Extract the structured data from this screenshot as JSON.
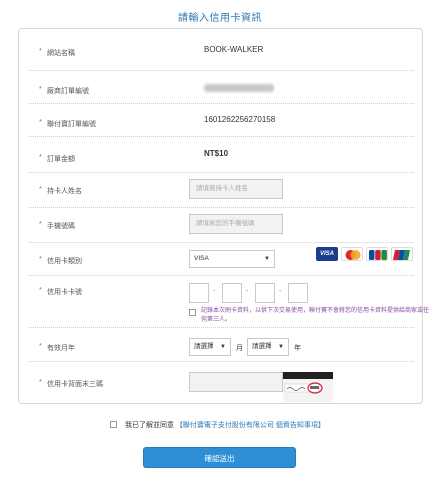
{
  "page": {
    "title": "請輸入信用卡資訊"
  },
  "form": {
    "site_name": {
      "label": "網站名稱",
      "value": "BOOK-WALKER"
    },
    "store_order": {
      "label": "廠商訂單編號",
      "value": ""
    },
    "payment_order": {
      "label": "聯付寶訂單編號",
      "value": "1601262256270158"
    },
    "amount": {
      "label": "訂單金額",
      "value": "NT$10"
    },
    "cardholder": {
      "label": "持卡人姓名",
      "placeholder": "請填寫持卡人姓名"
    },
    "phone": {
      "label": "手機號碼",
      "placeholder": "請填寫您的手機號碼"
    },
    "card_type": {
      "label": "信用卡類別",
      "selected": "VISA",
      "logos": [
        "VISA",
        "MasterCard",
        "JCB",
        "UnionPay"
      ]
    },
    "card_number": {
      "label": "信用卡卡號",
      "separator": "-",
      "remember_note": "記錄本次刷卡資料，以供下次交易使用，聯付寶不會將您的信用卡資料提供給商家或任何第三人。"
    },
    "expiry": {
      "label": "有效月年",
      "month_placeholder": "請選擇",
      "month_unit": "月",
      "year_placeholder": "請選擇",
      "year_unit": "年"
    },
    "cvv": {
      "label": "信用卡背面末三碼"
    },
    "required_mark": "*"
  },
  "agreement": {
    "text": "我已了解並同意",
    "link": "【聯付寶電子支付股份有限公司 個資告知事項】"
  },
  "submit": {
    "label": "確認送出"
  },
  "colors": {
    "accent": "#2a7ab5",
    "button": "#2f8fd6",
    "required": "#e0402f"
  }
}
